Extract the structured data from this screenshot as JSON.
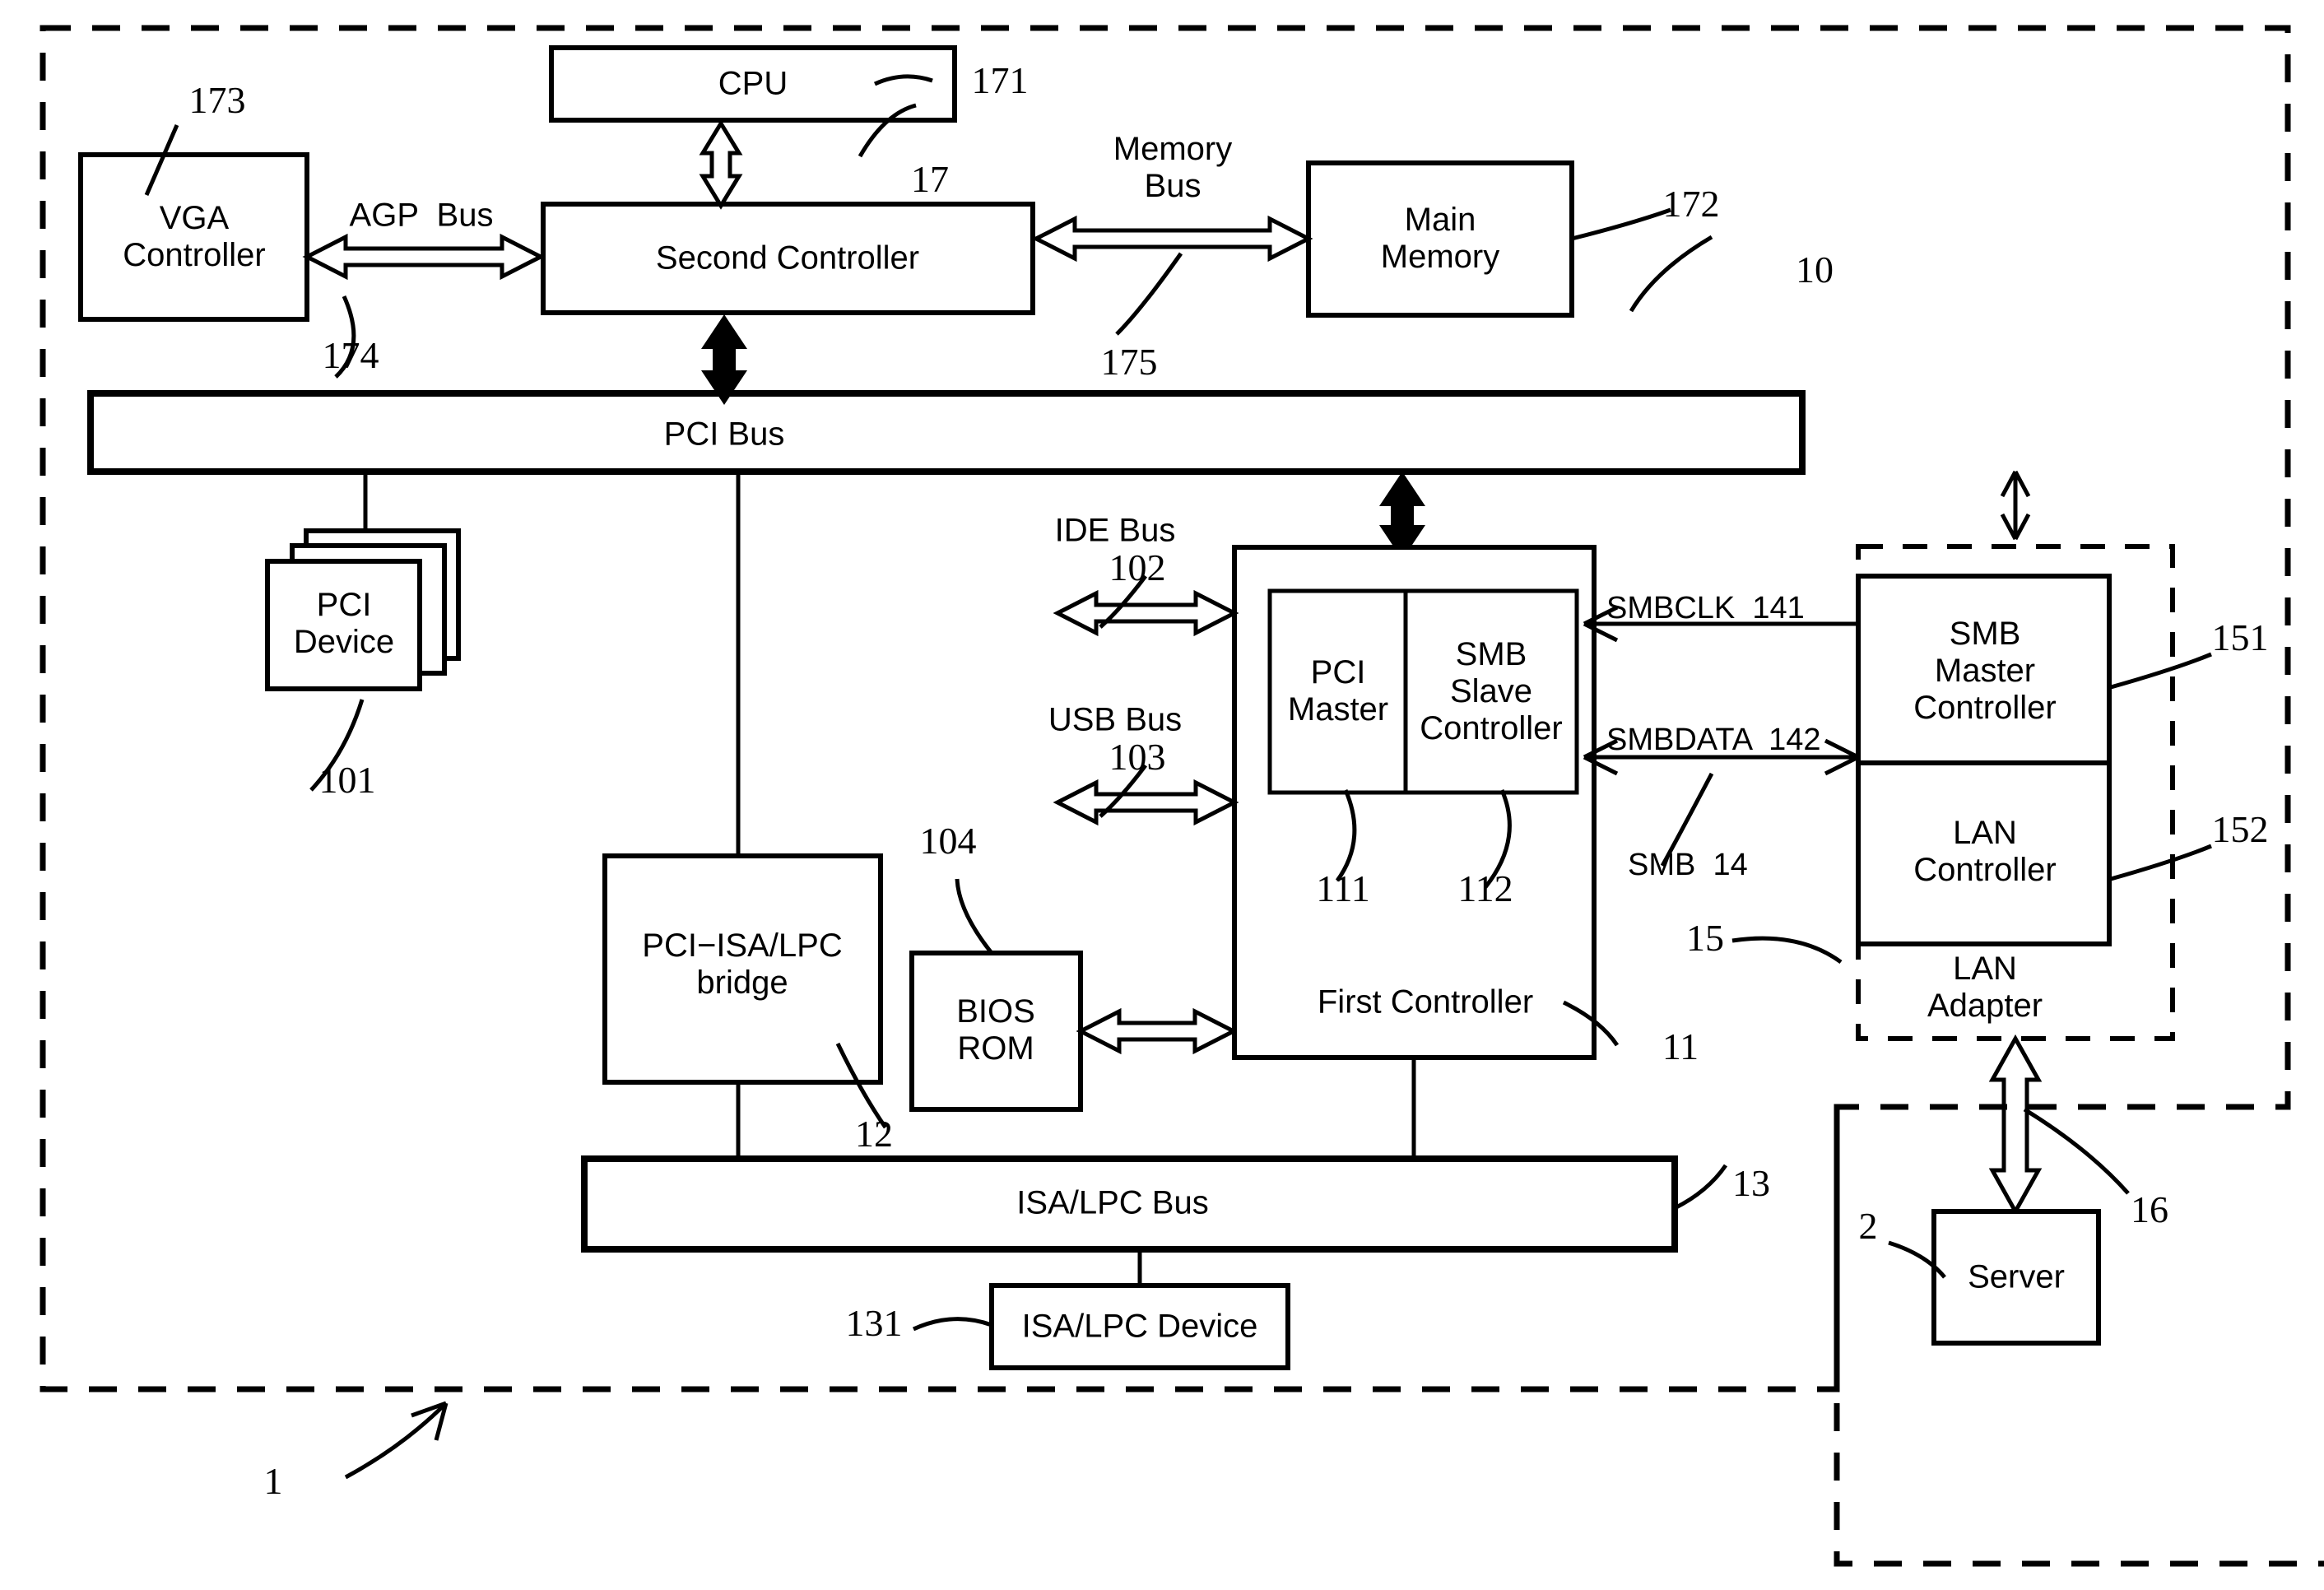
{
  "figure": {
    "type": "patent-block-diagram",
    "background": "#ffffff",
    "line_color": "#000000"
  },
  "blocks": {
    "cpu": "CPU",
    "vga_controller": "VGA\nController",
    "second_controller": "Second Controller",
    "main_memory": "Main\nMemory",
    "pci_bus": "PCI Bus",
    "pci_device": "PCI\nDevice",
    "pci_isa_lpc_bridge": "PCI−ISA/LPC\nbridge",
    "bios_rom": "BIOS\nROM",
    "first_controller": "First Controller",
    "pci_master": "PCI\nMaster",
    "smb_slave_controller": "SMB\nSlave\nController",
    "smb_master_controller": "SMB\nMaster\nController",
    "lan_controller": "LAN\nController",
    "lan_adapter": "LAN\nAdapter",
    "isa_lpc_bus": "ISA/LPC Bus",
    "isa_lpc_device": "ISA/LPC Device",
    "server": "Server"
  },
  "bus_labels": {
    "agp_bus": "AGP  Bus",
    "memory_bus": "Memory\nBus",
    "ide_bus": "IDE Bus",
    "usb_bus": "USB Bus"
  },
  "signal_labels": {
    "smbclk": "SMBCLK  141",
    "smbdata": "SMBDATA  142",
    "smb": "SMB  14"
  },
  "reference_numerals": {
    "system": "1",
    "server": "2",
    "pci_bus": "10",
    "pci_device": "101",
    "ide_bus": "102",
    "usb_bus": "103",
    "bios_rom": "104",
    "first_controller": "11",
    "pci_master": "111",
    "smb_slave_controller": "112",
    "bridge": "12",
    "isa_lpc_bus": "13",
    "isa_lpc_device": "131",
    "lan_adapter": "15",
    "smb_master_controller": "151",
    "lan_controller": "152",
    "lan_link": "16",
    "second_controller": "17",
    "cpu": "171",
    "main_memory": "172",
    "vga_controller": "173",
    "agp_bus": "174",
    "memory_bus": "175"
  }
}
